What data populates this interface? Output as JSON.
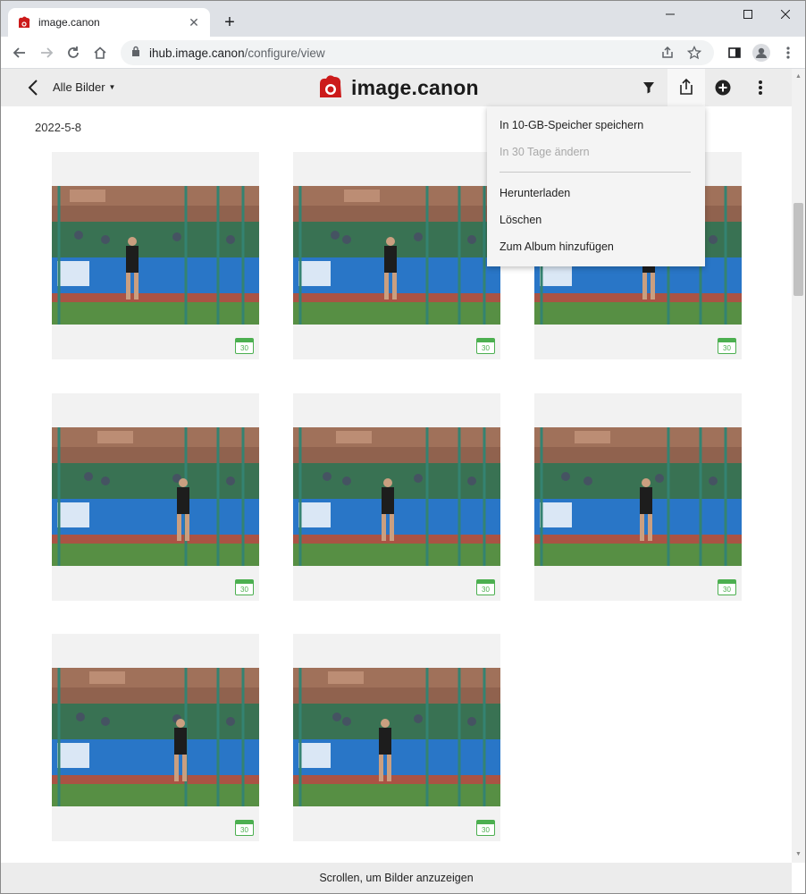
{
  "browser": {
    "tab_title": "image.canon",
    "new_tab_label": "+",
    "url_host": "ihub.image.canon",
    "url_path": "/configure/view",
    "window_controls": [
      "minimize",
      "maximize",
      "close"
    ]
  },
  "header": {
    "album_selector": "Alle Bilder",
    "logo_text": "image.canon",
    "brand_color": "#cc1a1a"
  },
  "menu": {
    "items": [
      {
        "label": "In 10-GB-Speicher speichern",
        "enabled": true
      },
      {
        "label": "In 30 Tage ändern",
        "enabled": false
      },
      {
        "label": "Herunterladen",
        "enabled": true
      },
      {
        "label": "Löschen",
        "enabled": true
      },
      {
        "label": "Zum Album hinzufügen",
        "enabled": true
      }
    ]
  },
  "content": {
    "date": "2022-5-8",
    "photos": [
      {
        "badge": "30",
        "alt": "discus-thrower-1"
      },
      {
        "badge": "30",
        "alt": "discus-thrower-2"
      },
      {
        "badge": "30",
        "alt": "discus-thrower-3"
      },
      {
        "badge": "30",
        "alt": "discus-thrower-4"
      },
      {
        "badge": "30",
        "alt": "discus-thrower-5"
      },
      {
        "badge": "30",
        "alt": "discus-thrower-6"
      },
      {
        "badge": "30",
        "alt": "discus-thrower-7"
      },
      {
        "badge": "30",
        "alt": "discus-thrower-8"
      }
    ]
  },
  "footer": {
    "text": "Scrollen, um Bilder anzuzeigen"
  },
  "colors": {
    "badge_green": "#4caf50",
    "banner_blue": "#1e6fc4"
  }
}
